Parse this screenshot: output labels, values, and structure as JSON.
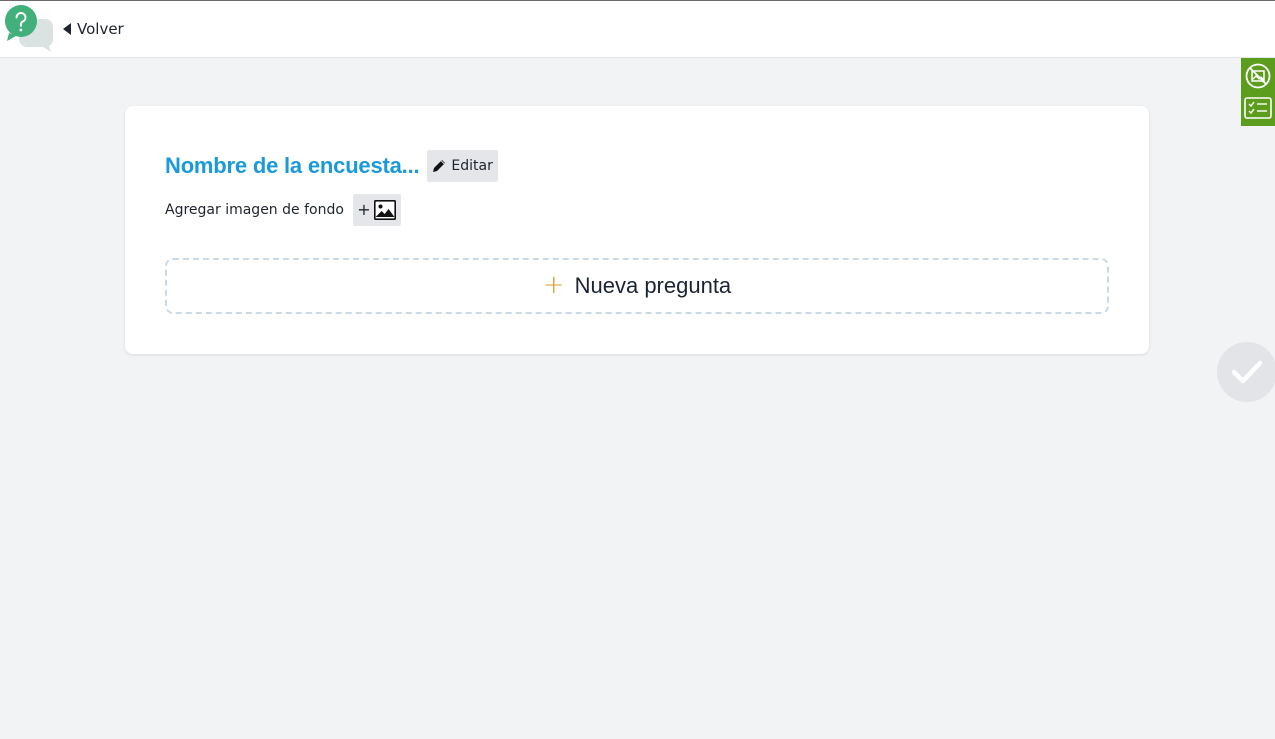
{
  "header": {
    "back_label": "Volver",
    "logo_icon": "question-chat-bubbles-icon"
  },
  "side_toolbar": {
    "color": "#5c9d1e",
    "tools": [
      "image-off-icon",
      "checklist-icon"
    ]
  },
  "survey": {
    "title": "Nombre de la encuesta...",
    "title_color": "#1a9ad9",
    "edit_label": "Editar",
    "background_label": "Agregar imagen de fondo",
    "add_background_plus": "+",
    "new_question_plus": "+",
    "new_question_label": "Nueva pregunta",
    "new_question_accent": "#d89b2b"
  },
  "confirm_icon": "checkmark-icon"
}
